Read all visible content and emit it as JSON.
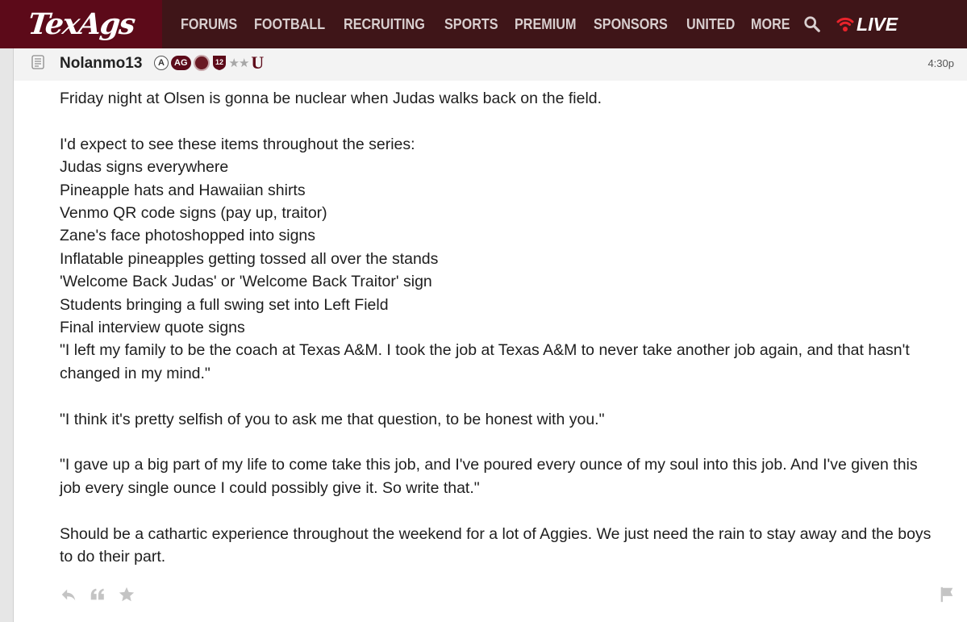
{
  "site": {
    "logo": "TexAgs"
  },
  "nav": {
    "items": [
      "FORUMS",
      "FOOTBALL",
      "RECRUITING",
      "SPORTS",
      "PREMIUM",
      "SPONSORS",
      "UNITED",
      "MORE"
    ],
    "live_label": "LIVE",
    "search_icon": "search-icon",
    "live_icon": "live-broadcast-icon"
  },
  "post": {
    "username": "Nolanmo13",
    "badge_a": "A",
    "badge_ag": "AG",
    "badge_12": "12",
    "badge_stars": "★★",
    "badge_u": "U",
    "time": "4:30p",
    "lines": [
      "Friday night at Olsen is gonna be nuclear when Judas walks back on the field.",
      "",
      "I'd expect to see these items throughout the series:",
      "Judas signs everywhere",
      "Pineapple hats and Hawaiian shirts",
      "Venmo QR code signs (pay up, traitor)",
      "Zane's face photoshopped into signs",
      "Inflatable pineapples getting tossed all over the stands",
      "'Welcome Back Judas' or 'Welcome Back Traitor' sign",
      "Students bringing a full swing set into Left Field",
      "Final interview quote signs",
      "\"I left my family to be the coach at Texas A&M. I took the job at Texas A&M to never take another job again, and that hasn't",
      "changed in my mind.\"",
      "",
      "\"I think it's pretty selfish of you to ask me that question, to be honest with you.\"",
      "",
      "\"I gave up a big part of my life to come take this job, and I've poured every ounce of my soul into this job. And I've given this",
      "job every single ounce I could possibly give it. So write that.\"",
      "",
      "Should be a cathartic experience throughout the weekend for a lot of Aggies. We just need the rain to stay away and the boys",
      "to do their part."
    ],
    "actions": [
      "reply-icon",
      "quote-icon",
      "star-icon"
    ],
    "flag_icon": "flag-icon"
  },
  "colors": {
    "nav_bg": "#3f1518",
    "logo_bg": "#5c0a19",
    "brand_maroon": "#5c0a19",
    "live_red": "#e8232b"
  }
}
